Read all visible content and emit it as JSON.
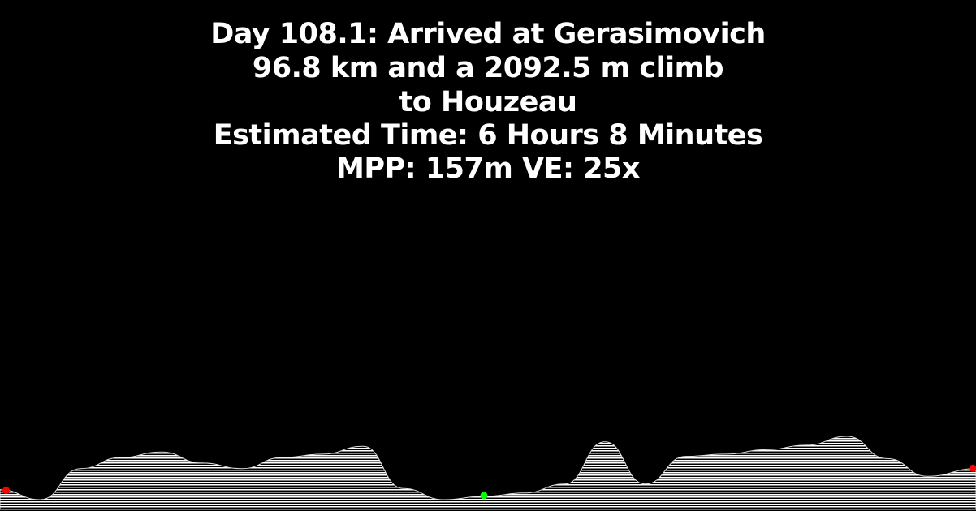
{
  "header": {
    "title": "Day 108.1: Arrived at Gerasimovich",
    "route_line1": "96.8 km and a 2092.5 m climb",
    "route_line2": "to Houzeau",
    "estimated_time": "Estimated Time: 6 Hours 8 Minutes",
    "scale": "MPP: 157m VE: 25x"
  },
  "colors": {
    "background": "#000000",
    "text": "#ffffff",
    "terrain_fill": "#c8c8c8",
    "terrain_hatch": "#ffffff",
    "start_marker": "#ff0000",
    "midpoint_marker": "#00ff00",
    "end_marker": "#ff0000"
  },
  "chart_data": {
    "type": "area",
    "title": "",
    "xlabel": "",
    "ylabel": "",
    "x_km": [
      0,
      4,
      8,
      12,
      16,
      20,
      24,
      28,
      32,
      36,
      40,
      44,
      48,
      52,
      56,
      60,
      64,
      68,
      72,
      76,
      80,
      84,
      88,
      92,
      96.8
    ],
    "elevation_m": [
      450,
      0,
      1400,
      1900,
      2150,
      1650,
      1400,
      1900,
      2050,
      2400,
      500,
      0,
      150,
      300,
      700,
      2600,
      700,
      1950,
      2050,
      2250,
      2450,
      2850,
      1850,
      1050,
      1400
    ],
    "markers": [
      {
        "name": "start",
        "x_km": 0.6,
        "color": "#ff0000"
      },
      {
        "name": "midpoint",
        "x_km": 48.0,
        "color": "#00ff00"
      },
      {
        "name": "end",
        "x_km": 96.5,
        "color": "#ff0000"
      }
    ]
  }
}
